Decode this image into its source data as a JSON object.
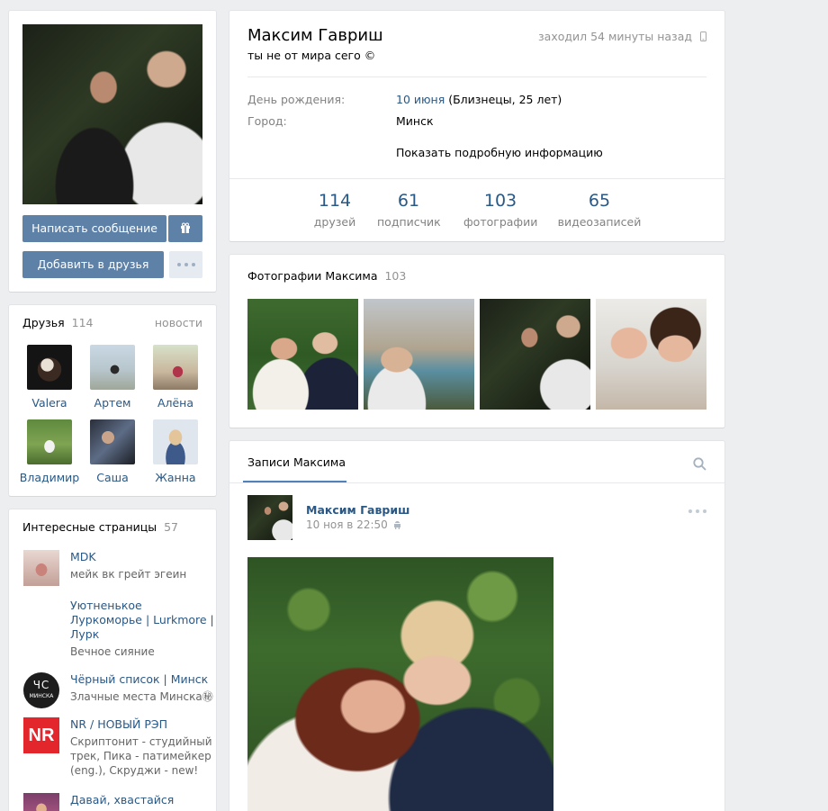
{
  "profile": {
    "name": "Максим Гавриш",
    "status": "ты не от мира сего ©",
    "last_seen": "заходил 54 минуты назад",
    "birthday_label": "День рождения:",
    "birthday_link": "10 июня",
    "birthday_rest": " (Близнецы, 25 лет)",
    "city_label": "Город:",
    "city": "Минск",
    "show_more": "Показать подробную информацию",
    "counters": [
      {
        "num": "114",
        "label": "друзей"
      },
      {
        "num": "61",
        "label": "подписчик"
      },
      {
        "num": "103",
        "label": "фотографии"
      },
      {
        "num": "65",
        "label": "видеозаписей"
      }
    ]
  },
  "actions": {
    "message_btn": "Написать сообщение",
    "add_friend_btn": "Добавить в друзья"
  },
  "friends": {
    "title": "Друзья",
    "count": "114",
    "news_link": "новости",
    "items": [
      {
        "name": "Valera"
      },
      {
        "name": "Артем"
      },
      {
        "name": "Алёна"
      },
      {
        "name": "Владимир"
      },
      {
        "name": "Саша"
      },
      {
        "name": "Жанна"
      }
    ]
  },
  "pages": {
    "title": "Интересные страницы",
    "count": "57",
    "items": [
      {
        "name": "MDK",
        "sub": "мейк вк грейт эгеин"
      },
      {
        "name": "Уютненькое Луркоморье | Lurkmore | Лурк",
        "sub": "Вечное сияние"
      },
      {
        "name": "Чёрный список | Минск",
        "sub": "Злачные места Минска㊙"
      },
      {
        "name": "NR / НОВЫЙ РЭП",
        "sub": "Скриптонит - студийный трек, Пика - патимейкер (eng.), Скруджи - new!"
      },
      {
        "name": "Давай, хвастайся",
        "sub": ""
      }
    ],
    "cs_icon_text": "ЧС",
    "cs_icon_sub": "МИНСКА",
    "nr_icon_text": "NR"
  },
  "photos": {
    "title": "Фотографии Максима",
    "count": "103"
  },
  "wall": {
    "tab": "Записи Максима",
    "post_author": "Максим Гавриш",
    "post_date": "10 ноя в 22:50"
  },
  "icons": {
    "mobile": "mobile-icon",
    "gift": "gift-icon",
    "more": "more-icon",
    "search": "search-icon",
    "android": "android-icon"
  },
  "colors": {
    "link": "#2a5885",
    "button": "#5e81a8",
    "bg": "#edeef0"
  }
}
